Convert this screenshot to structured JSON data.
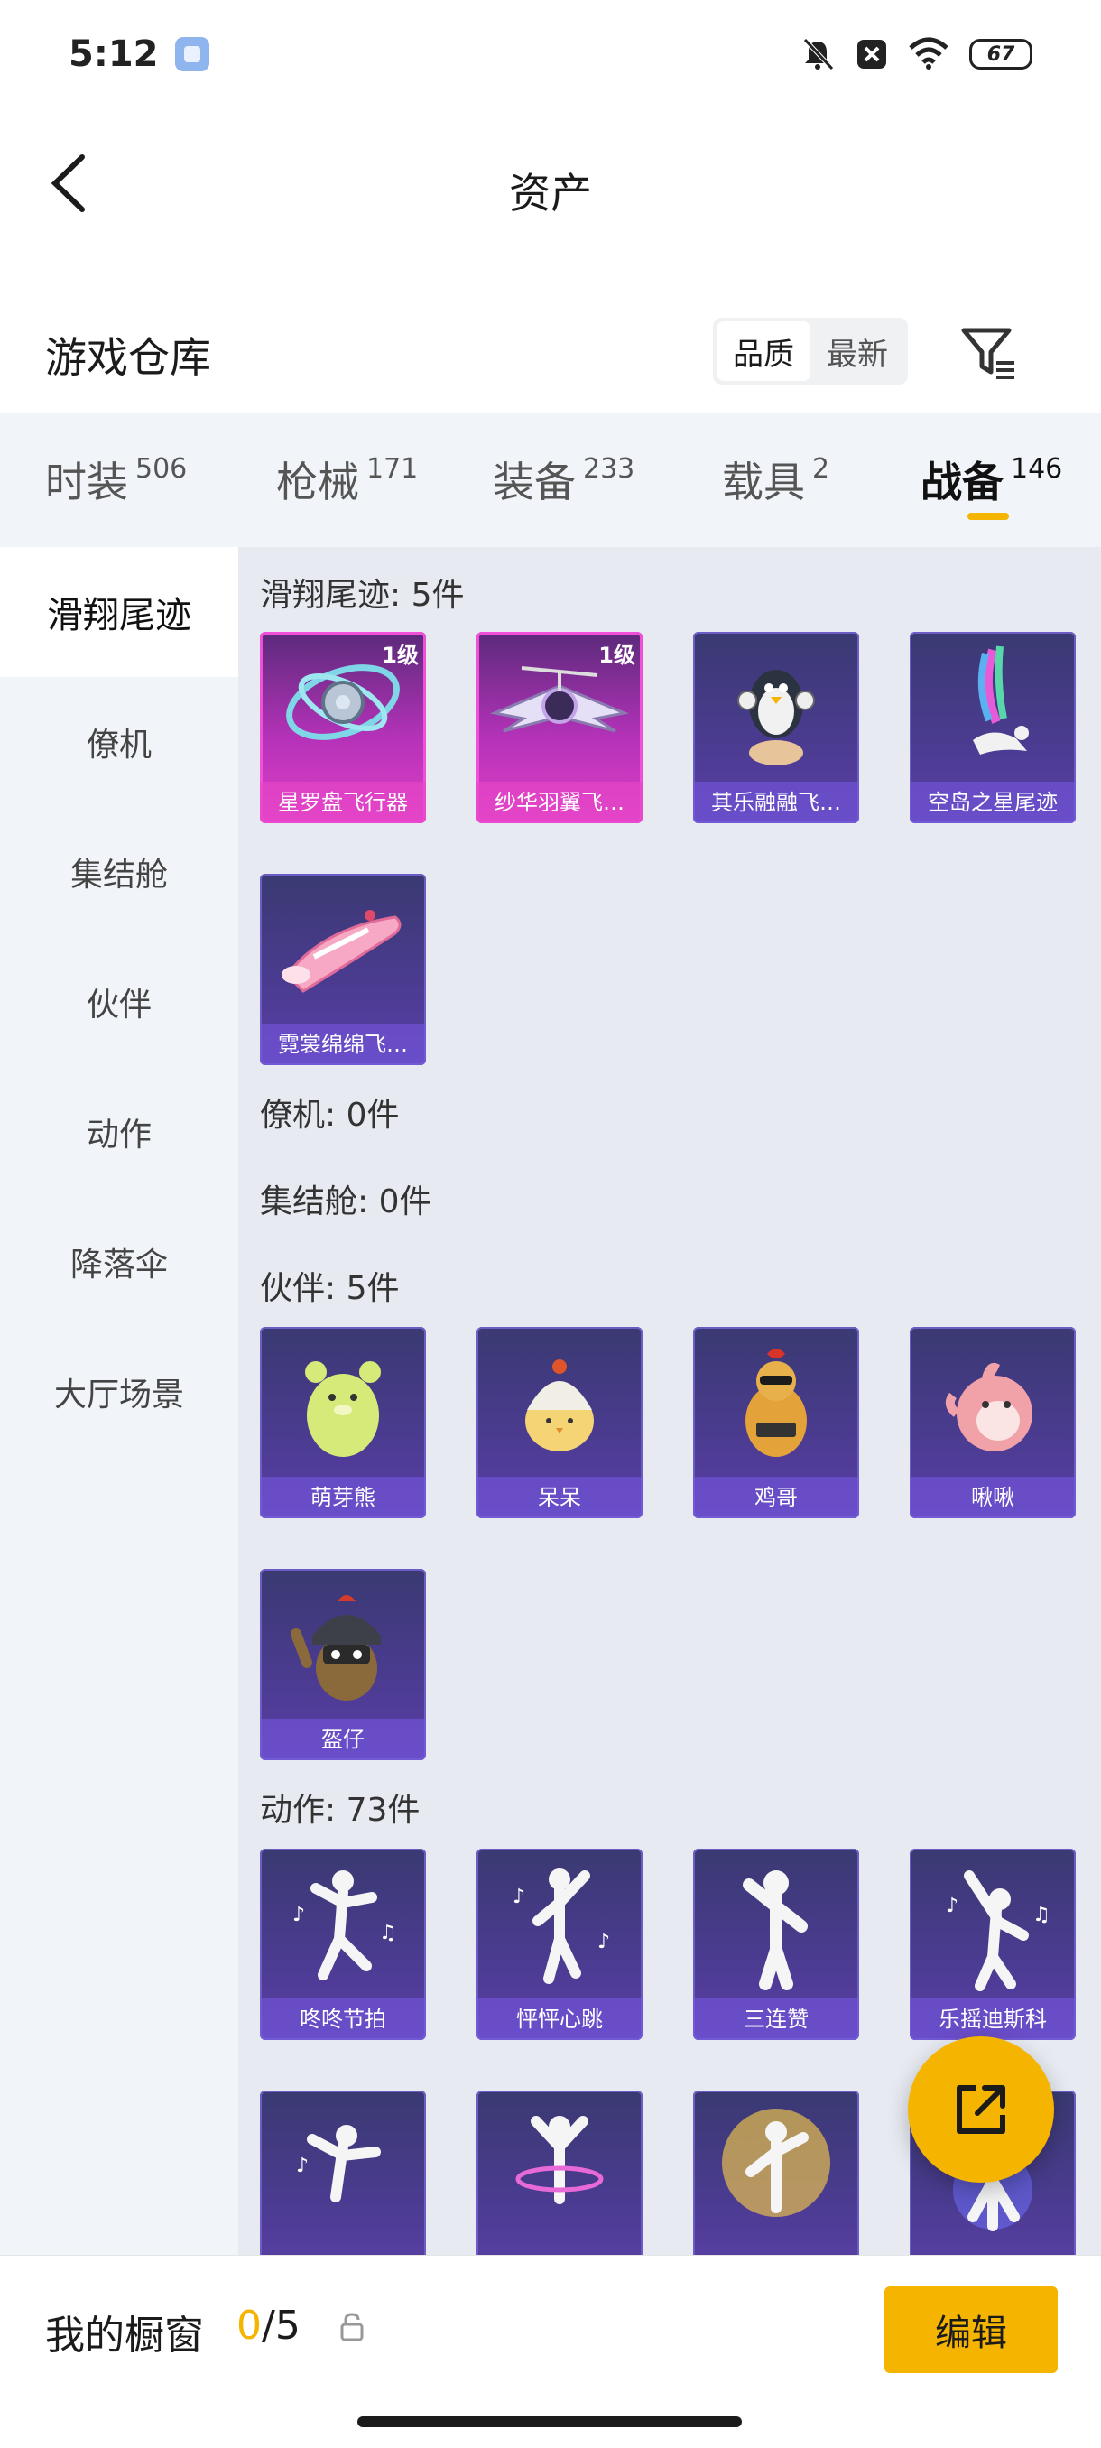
{
  "status_bar": {
    "time": "5:12",
    "battery": "67"
  },
  "nav": {
    "title": "资产"
  },
  "header": {
    "title": "游戏仓库",
    "sort_options": [
      "品质",
      "最新"
    ],
    "active_sort": "品质"
  },
  "tabs": [
    {
      "label": "时装",
      "count": "506"
    },
    {
      "label": "枪械",
      "count": "171"
    },
    {
      "label": "装备",
      "count": "233"
    },
    {
      "label": "载具",
      "count": "2"
    },
    {
      "label": "战备",
      "count": "146"
    }
  ],
  "active_tab": "战备",
  "sidebar": {
    "items": [
      "滑翔尾迹",
      "僚机",
      "集结舱",
      "伙伴",
      "动作",
      "降落伞",
      "大厅场景"
    ],
    "active": "滑翔尾迹"
  },
  "sections": {
    "glide": {
      "title": "滑翔尾迹: 5件",
      "items": [
        {
          "name": "星罗盘飞行器",
          "level": "1级"
        },
        {
          "name": "纱华羽翼飞…",
          "level": "1级"
        },
        {
          "name": "其乐融融飞…"
        },
        {
          "name": "空岛之星尾迹"
        },
        {
          "name": "霓裳绵绵飞…"
        }
      ]
    },
    "wingman": {
      "title": "僚机: 0件"
    },
    "rally": {
      "title": "集结舱: 0件"
    },
    "partner": {
      "title": "伙伴: 5件",
      "items": [
        {
          "name": "萌芽熊"
        },
        {
          "name": "呆呆"
        },
        {
          "name": "鸡哥"
        },
        {
          "name": "啾啾"
        },
        {
          "name": "盔仔"
        }
      ]
    },
    "emote": {
      "title": "动作: 73件",
      "items": [
        {
          "name": "咚咚节拍"
        },
        {
          "name": "怦怦心跳"
        },
        {
          "name": "三连赞"
        },
        {
          "name": "乐摇迪斯科"
        }
      ]
    }
  },
  "bottom": {
    "showcase_label": "我的橱窗",
    "current": "0",
    "total": "/5",
    "edit_label": "编辑"
  },
  "colors": {
    "accent": "#f5b400",
    "rare_purple": "#4a3b8f",
    "epic_magenta": "#e040c8"
  }
}
